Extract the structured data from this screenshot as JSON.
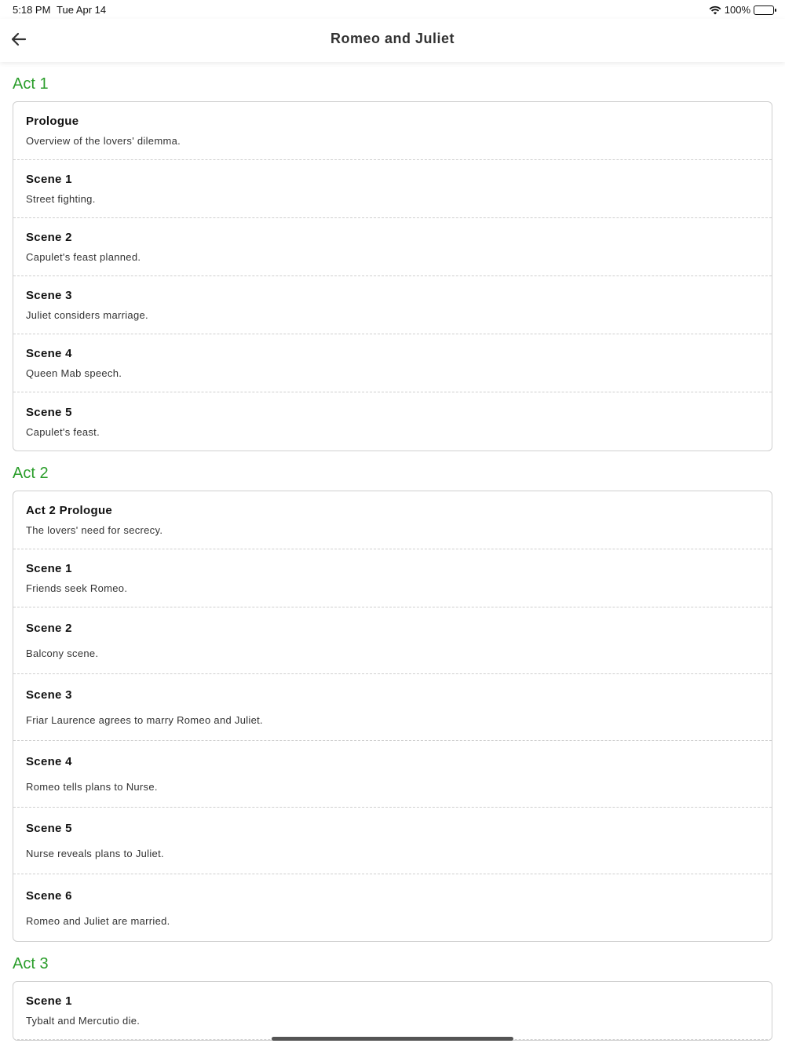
{
  "status_bar": {
    "time": "5:18 PM",
    "date": "Tue Apr 14",
    "battery": "100%"
  },
  "nav": {
    "title": "Romeo and Juliet",
    "back_icon": "arrow-left-icon"
  },
  "acts": [
    {
      "title": "Act 1",
      "scenes": [
        {
          "title": "Prologue",
          "desc": "Overview of the lovers' dilemma."
        },
        {
          "title": "Scene 1",
          "desc": "Street fighting."
        },
        {
          "title": "Scene 2",
          "desc": "Capulet's feast planned."
        },
        {
          "title": "Scene 3",
          "desc": "Juliet considers marriage."
        },
        {
          "title": "Scene 4",
          "desc": "Queen Mab speech."
        },
        {
          "title": "Scene 5",
          "desc": "Capulet's feast."
        }
      ]
    },
    {
      "title": "Act 2",
      "scenes": [
        {
          "title": "Act 2 Prologue",
          "desc": "The lovers' need for secrecy."
        },
        {
          "title": "Scene 1",
          "desc": "Friends seek Romeo."
        },
        {
          "title": "Scene 2",
          "desc": "Balcony scene."
        },
        {
          "title": "Scene 3",
          "desc": "Friar Laurence agrees to marry Romeo and Juliet."
        },
        {
          "title": "Scene 4",
          "desc": "Romeo tells plans to Nurse."
        },
        {
          "title": "Scene 5",
          "desc": "Nurse reveals plans to Juliet."
        },
        {
          "title": "Scene 6",
          "desc": "Romeo and Juliet are married."
        }
      ]
    },
    {
      "title": "Act 3",
      "scenes": [
        {
          "title": "Scene 1",
          "desc": "Tybalt and Mercutio die."
        }
      ]
    }
  ],
  "colors": {
    "act_heading": "#2a9d2a",
    "card_border": "#cfcfcf"
  }
}
